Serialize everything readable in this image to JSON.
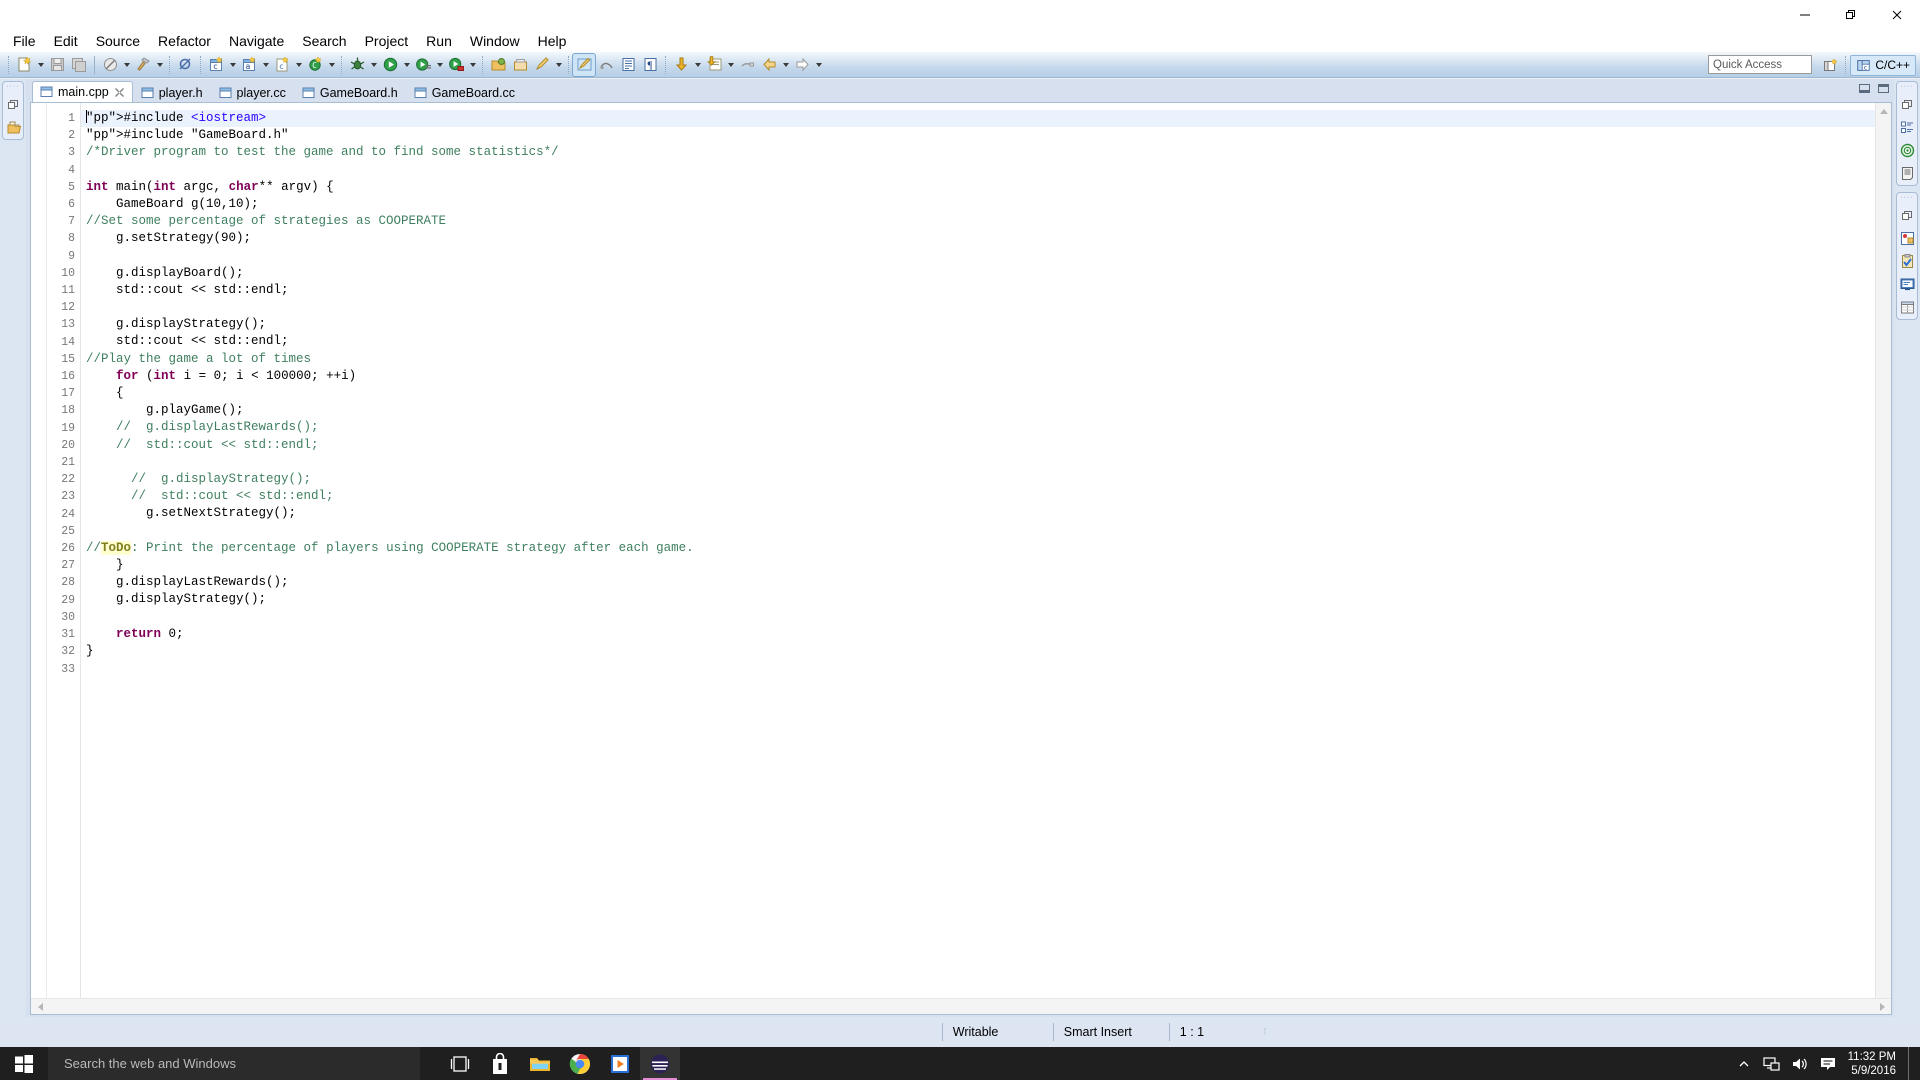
{
  "window": {
    "controls": {
      "minimize": "—",
      "maximize": "❐",
      "close": "✕"
    }
  },
  "menu": {
    "items": [
      "File",
      "Edit",
      "Source",
      "Refactor",
      "Navigate",
      "Search",
      "Project",
      "Run",
      "Window",
      "Help"
    ]
  },
  "toolbar": {
    "quick_access_placeholder": "Quick Access",
    "perspective_label": "C/C++",
    "buttons": [
      "new-c-cpp-file",
      "save",
      "save-all",
      "build-all-hammer",
      "build-configurations",
      "skip-all-breakpoints",
      "new-c-project",
      "new-class",
      "new-source-file",
      "new-cpp-class",
      "debug",
      "run",
      "run-external-tools",
      "run-coverage",
      "open-declaration",
      "open-element",
      "search",
      "toggle-mark-occurrences",
      "show-whitespace",
      "show-print-margin",
      "next-annotation",
      "previous-annotation",
      "last-edit-location",
      "back",
      "forward"
    ]
  },
  "editor": {
    "tabs": [
      {
        "label": "main.cpp",
        "active": true,
        "closeable": true
      },
      {
        "label": "player.h",
        "active": false,
        "closeable": false
      },
      {
        "label": "player.cc",
        "active": false,
        "closeable": false
      },
      {
        "label": "GameBoard.h",
        "active": false,
        "closeable": false
      },
      {
        "label": "GameBoard.cc",
        "active": false,
        "closeable": false
      }
    ],
    "line_numbers": [
      1,
      2,
      3,
      4,
      5,
      6,
      7,
      8,
      9,
      10,
      11,
      12,
      13,
      14,
      15,
      16,
      17,
      18,
      19,
      20,
      21,
      22,
      23,
      24,
      25,
      26,
      27,
      28,
      29,
      30,
      31,
      32,
      33
    ],
    "lines": [
      "#include <iostream>",
      "#include \"GameBoard.h\"",
      "/*Driver program to test the game and to find some statistics*/",
      "",
      "int main(int argc, char** argv) {",
      "    GameBoard g(10,10);",
      "//Set some percentage of strategies as COOPERATE",
      "    g.setStrategy(90);",
      "",
      "    g.displayBoard();",
      "    std::cout << std::endl;",
      "",
      "    g.displayStrategy();",
      "    std::cout << std::endl;",
      "//Play the game a lot of times",
      "    for (int i = 0; i < 100000; ++i)",
      "    {",
      "        g.playGame();",
      "    //  g.displayLastRewards();",
      "    //  std::cout << std::endl;",
      "",
      "      //  g.displayStrategy();",
      "      //  std::cout << std::endl;",
      "        g.setNextStrategy();",
      "",
      "//ToDo: Print the percentage of players using COOPERATE strategy after each game.",
      "    }",
      "    g.displayLastRewards();",
      "    g.displayStrategy();",
      "",
      "    return 0;",
      "}",
      ""
    ]
  },
  "status": {
    "writable": "Writable",
    "insert_mode": "Smart Insert",
    "cursor_position": "1 : 1"
  },
  "taskbar": {
    "search_placeholder": "Search the web and Windows",
    "apps": [
      "task-view",
      "store",
      "file-explorer",
      "chrome",
      "video-player",
      "eclipse"
    ],
    "time": "11:32 PM",
    "date": "5/9/2016"
  },
  "colors": {
    "toolbar_blue": "#b6cfe6",
    "statusbar": "#dde5f3",
    "keyword": "#7f0055",
    "string": "#2a00ff",
    "comment": "#3f7f5f",
    "todo": "#7f7f1f",
    "taskbar": "#1f1f1f"
  }
}
